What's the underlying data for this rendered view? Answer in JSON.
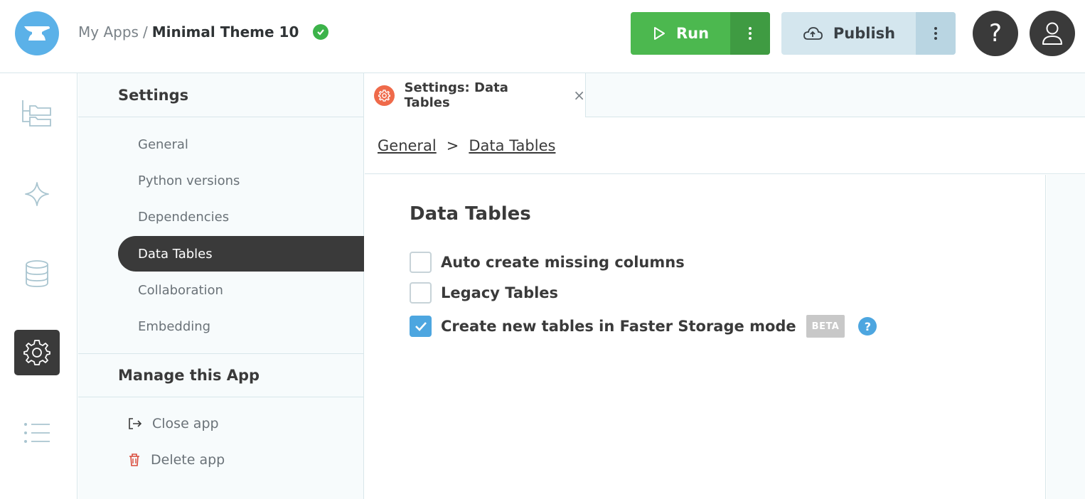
{
  "header": {
    "breadcrumb_root": "My Apps",
    "breadcrumb_sep": "/",
    "app_name": "Minimal Theme 10",
    "run_label": "Run",
    "publish_label": "Publish",
    "help_label": "?"
  },
  "rail": {
    "icons": [
      "app-browser-icon",
      "sparkle-icon",
      "database-icon",
      "gear-icon",
      "list-icon"
    ],
    "active": "gear-icon"
  },
  "settings": {
    "title": "Settings",
    "items": [
      {
        "label": "General"
      },
      {
        "label": "Python versions"
      },
      {
        "label": "Dependencies"
      },
      {
        "label": "Data Tables",
        "active": true
      },
      {
        "label": "Collaboration"
      },
      {
        "label": "Embedding"
      }
    ],
    "manage_title": "Manage this App",
    "manage_items": [
      {
        "label": "Close app",
        "icon": "exit-icon"
      },
      {
        "label": "Delete app",
        "icon": "trash-icon"
      }
    ]
  },
  "tab": {
    "label": "Settings: Data Tables",
    "close": "×"
  },
  "breadcrumb": {
    "items": [
      "General",
      "Data Tables"
    ],
    "sep": ">"
  },
  "content": {
    "title": "Data Tables",
    "options": [
      {
        "label": "Auto create missing columns",
        "checked": false
      },
      {
        "label": "Legacy Tables",
        "checked": false
      },
      {
        "label": "Create new tables in Faster Storage mode",
        "checked": true,
        "badge": "BETA",
        "help": "?"
      }
    ]
  },
  "colors": {
    "accent": "#4da6e0",
    "run": "#4cb84f",
    "publish": "#d4e6ee",
    "dark": "#3a3a3a",
    "success": "#3cb34a"
  }
}
